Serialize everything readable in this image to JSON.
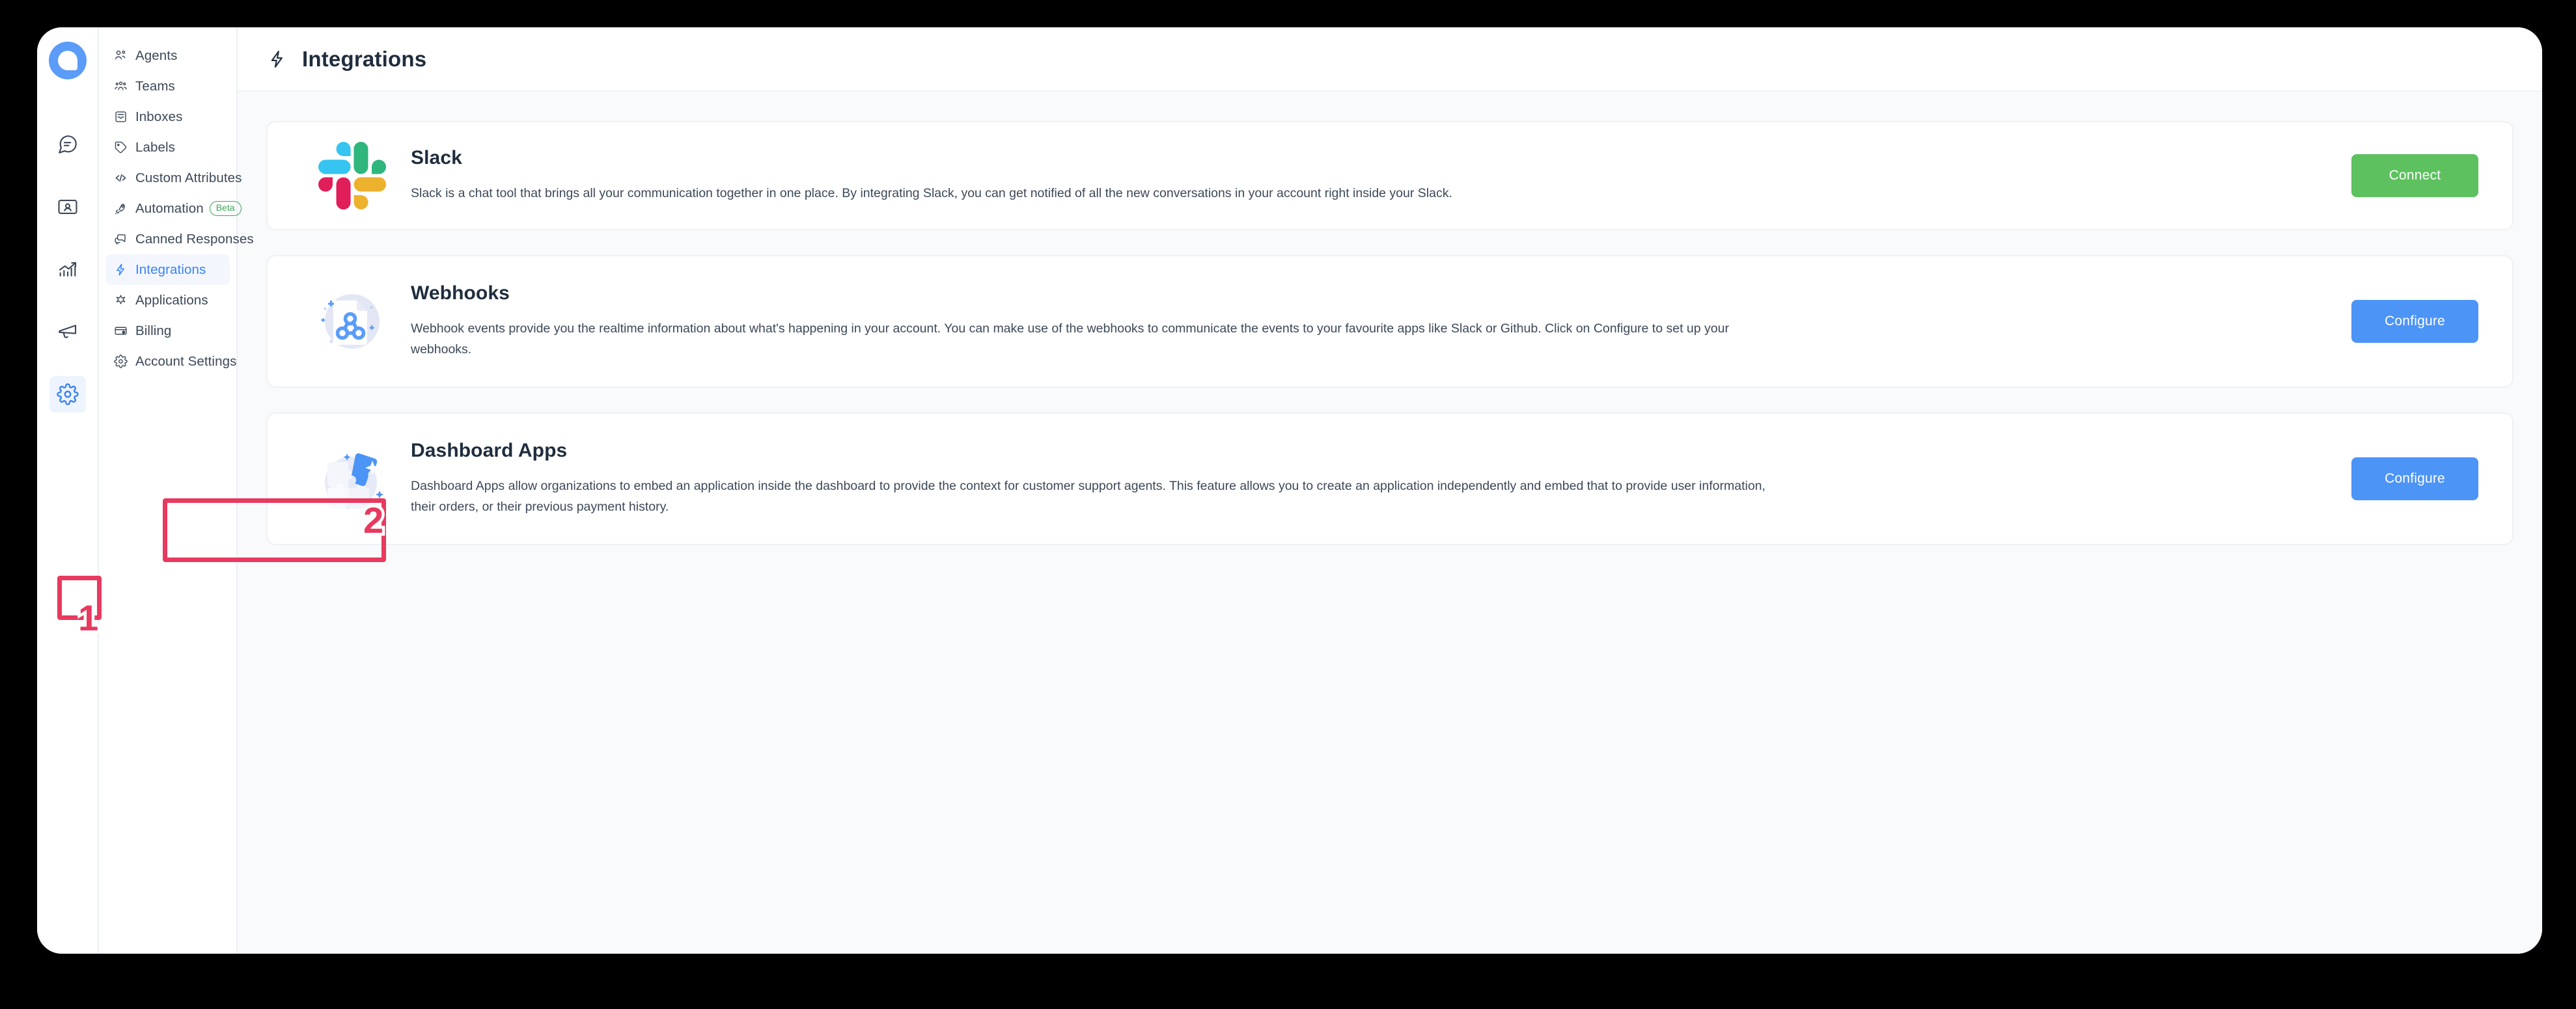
{
  "window": {
    "title": "Chatwoot Integrations"
  },
  "rail": {
    "logo_name": "chatwoot-logo",
    "items": [
      {
        "name": "conversations-icon",
        "label": "Conversations",
        "active": false
      },
      {
        "name": "contacts-icon",
        "label": "Contacts",
        "active": false
      },
      {
        "name": "reports-icon",
        "label": "Reports",
        "active": false
      },
      {
        "name": "campaigns-icon",
        "label": "Campaigns",
        "active": false
      },
      {
        "name": "settings-gear-icon",
        "label": "Settings",
        "active": true
      }
    ]
  },
  "sidebar": {
    "items": [
      {
        "label": "Agents",
        "icon": "agents-icon",
        "active": false,
        "badge": null
      },
      {
        "label": "Teams",
        "icon": "teams-icon",
        "active": false,
        "badge": null
      },
      {
        "label": "Inboxes",
        "icon": "inboxes-icon",
        "active": false,
        "badge": null
      },
      {
        "label": "Labels",
        "icon": "labels-tag-icon",
        "active": false,
        "badge": null
      },
      {
        "label": "Custom Attributes",
        "icon": "code-brackets-icon",
        "active": false,
        "badge": null
      },
      {
        "label": "Automation",
        "icon": "automation-rocket-icon",
        "active": false,
        "badge": "Beta"
      },
      {
        "label": "Canned Responses",
        "icon": "canned-responses-chat-icon",
        "active": false,
        "badge": null
      },
      {
        "label": "Integrations",
        "icon": "integrations-bolt-icon",
        "active": true,
        "badge": null
      },
      {
        "label": "Applications",
        "icon": "applications-star-icon",
        "active": false,
        "badge": null
      },
      {
        "label": "Billing",
        "icon": "billing-card-icon",
        "active": false,
        "badge": null
      },
      {
        "label": "Account Settings",
        "icon": "account-settings-gear-icon",
        "active": false,
        "badge": null
      }
    ]
  },
  "header": {
    "icon": "bolt-icon",
    "title": "Integrations"
  },
  "cards": [
    {
      "logo": "slack-logo",
      "title": "Slack",
      "description": "Slack is a chat tool that brings all your communication together in one place. By integrating Slack, you can get notified of all the new conversations in your account right inside your Slack.",
      "button_label": "Connect",
      "button_color": "#5cc15e"
    },
    {
      "logo": "webhook-illustration",
      "title": "Webhooks",
      "description": "Webhook events provide you the realtime information about what's happening in your account. You can make use of the webhooks to communicate the events to your favourite apps like Slack or Github. Click on Configure to set up your webhooks.",
      "button_label": "Configure",
      "button_color": "#4c94f6"
    },
    {
      "logo": "dashboard-apps-puzzle-illustration",
      "title": "Dashboard Apps",
      "description": "Dashboard Apps allow organizations to embed an application inside the dashboard to provide the context for customer support agents. This feature allows you to create an application independently and embed that to provide user information, their orders, or their previous payment history.",
      "button_label": "Configure",
      "button_color": "#4c94f6"
    }
  ],
  "annotations": [
    {
      "number": "1",
      "target": "settings-gear-icon"
    },
    {
      "number": "2",
      "target": "sidebar-item-integrations"
    }
  ],
  "colors": {
    "accent_blue": "#3b82f6",
    "annotation_red": "#e8395f",
    "connect_green": "#5cc15e",
    "configure_blue": "#4c94f6",
    "beta_green": "#3aa655"
  }
}
